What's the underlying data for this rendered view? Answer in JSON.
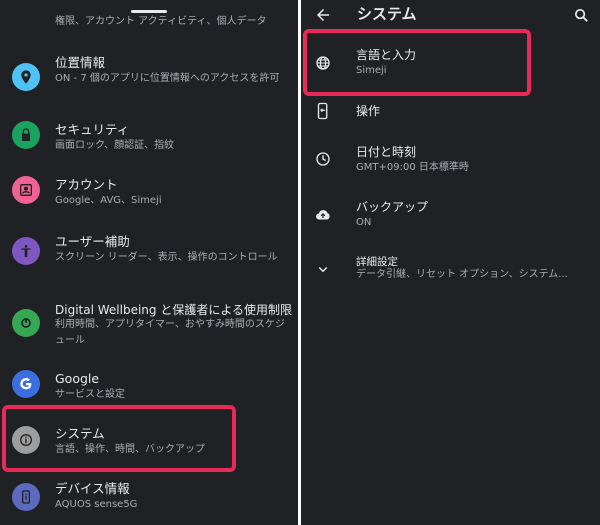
{
  "left": {
    "top_partial_text": "権限、アカウント アクティビティ、個人データ",
    "items": [
      {
        "title": "位置情報",
        "subtitle": "ON - 7 個のアプリに位置情報へのアクセスを許可",
        "color": "#4fc3f7"
      },
      {
        "title": "セキュリティ",
        "subtitle": "画面ロック、顔認証、指紋",
        "color": "#1aa260"
      },
      {
        "title": "アカウント",
        "subtitle": "Google、AVG、Simeji",
        "color": "#f06292"
      },
      {
        "title": "ユーザー補助",
        "subtitle": "スクリーン リーダー、表示、操作のコントロール",
        "color": "#7e57c2"
      },
      {
        "title": "Digital Wellbeing と保護者による使用制限",
        "subtitle": "利用時間、アプリタイマー、おやすみ時間のスケジュール",
        "color": "#34a853"
      },
      {
        "title": "Google",
        "subtitle": "サービスと設定",
        "color": "#3b6fe0"
      },
      {
        "title": "システム",
        "subtitle": "言語、操作、時間、バックアップ",
        "color": "#9e9e9e"
      },
      {
        "title": "デバイス情報",
        "subtitle": "AQUOS sense5G",
        "color": "#5c6bc0"
      }
    ]
  },
  "right": {
    "title": "システム",
    "items": [
      {
        "title": "言語と入力",
        "subtitle": "Simeji"
      },
      {
        "title": "操作",
        "subtitle": ""
      },
      {
        "title": "日付と時刻",
        "subtitle": "GMT+09:00 日本標準時"
      },
      {
        "title": "バックアップ",
        "subtitle": "ON"
      },
      {
        "title": "詳細設定",
        "subtitle": "データ引継、リセット オプション、システム..."
      }
    ]
  },
  "colors": {
    "background": "#202124",
    "highlight": "#e8295a",
    "text_primary": "#e8eaed",
    "text_secondary": "#a9adb2"
  },
  "icons": {
    "left": [
      "location-pin-icon",
      "lock-icon",
      "account-icon",
      "accessibility-icon",
      "wellbeing-icon",
      "google-icon",
      "info-icon",
      "device-info-icon"
    ],
    "right": [
      "globe-icon",
      "gesture-phone-icon",
      "clock-icon",
      "cloud-upload-icon",
      "chevron-down-icon"
    ]
  }
}
